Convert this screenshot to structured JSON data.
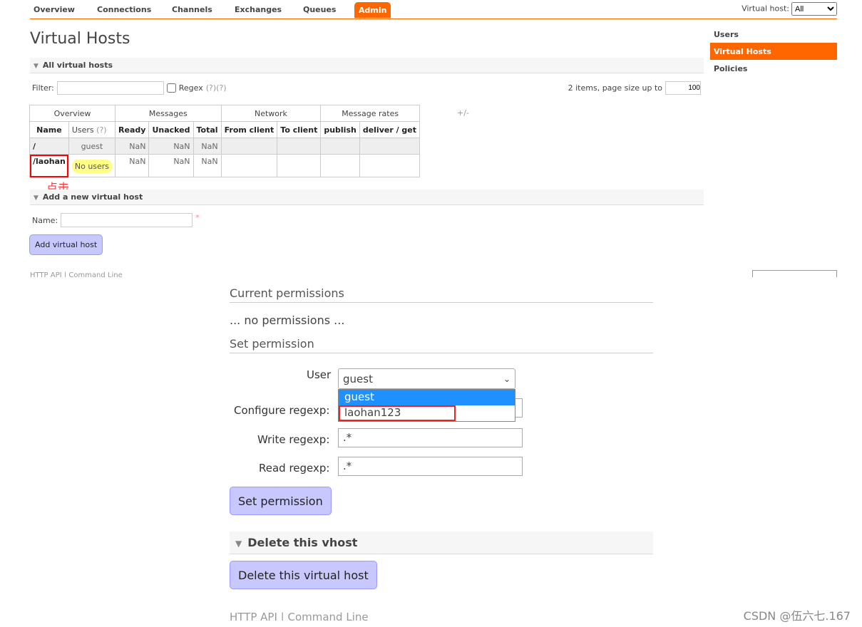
{
  "nav": {
    "tabs": [
      "Overview",
      "Connections",
      "Channels",
      "Exchanges",
      "Queues",
      "Admin"
    ],
    "active": "Admin",
    "vhost_label": "Virtual host:",
    "vhost_value": "All"
  },
  "title": "Virtual Hosts",
  "sidebar": [
    "Users",
    "Virtual Hosts",
    "Policies"
  ],
  "all": {
    "section": "All virtual hosts",
    "filter_label": "Filter:",
    "regex": "Regex",
    "help": "(?)(?)",
    "items_text": "2 items, page size up to",
    "page_size": "100",
    "groups": [
      "Overview",
      "Messages",
      "Network",
      "Message rates"
    ],
    "plusminus": "+/-",
    "columns": [
      "Name",
      "Users",
      "Ready",
      "Unacked",
      "Total",
      "From client",
      "To client",
      "publish",
      "deliver / get"
    ],
    "users_help": "(?)",
    "rows": [
      {
        "name": "/",
        "users": "guest",
        "ready": "NaN",
        "unacked": "NaN",
        "total": "NaN"
      },
      {
        "name": "/laohan",
        "users": "No users",
        "ready": "NaN",
        "unacked": "NaN",
        "total": "NaN"
      }
    ],
    "annotation": "点击"
  },
  "add": {
    "section": "Add a new virtual host",
    "name_label": "Name:",
    "required": "*",
    "button": "Add virtual host"
  },
  "footer": {
    "http_api": "HTTP API",
    "cli": "Command Line"
  },
  "perm": {
    "current": "Current permissions",
    "none": "... no permissions ...",
    "set": "Set permission",
    "user_label": "User",
    "user_value": "guest",
    "options": [
      "guest",
      "laohan123"
    ],
    "configure_label": "Configure regexp:",
    "write_label": "Write regexp:",
    "write_value": ".*",
    "read_label": "Read regexp:",
    "read_value": ".*",
    "button": "Set permission"
  },
  "del": {
    "section": "Delete this vhost",
    "button": "Delete this virtual host"
  },
  "watermark": "CSDN @伍六七.167",
  "colors": {
    "accent": "#ff6600",
    "highlight": "#ffff88",
    "annotation": "#ff0000",
    "button": "#c8c8ff"
  }
}
